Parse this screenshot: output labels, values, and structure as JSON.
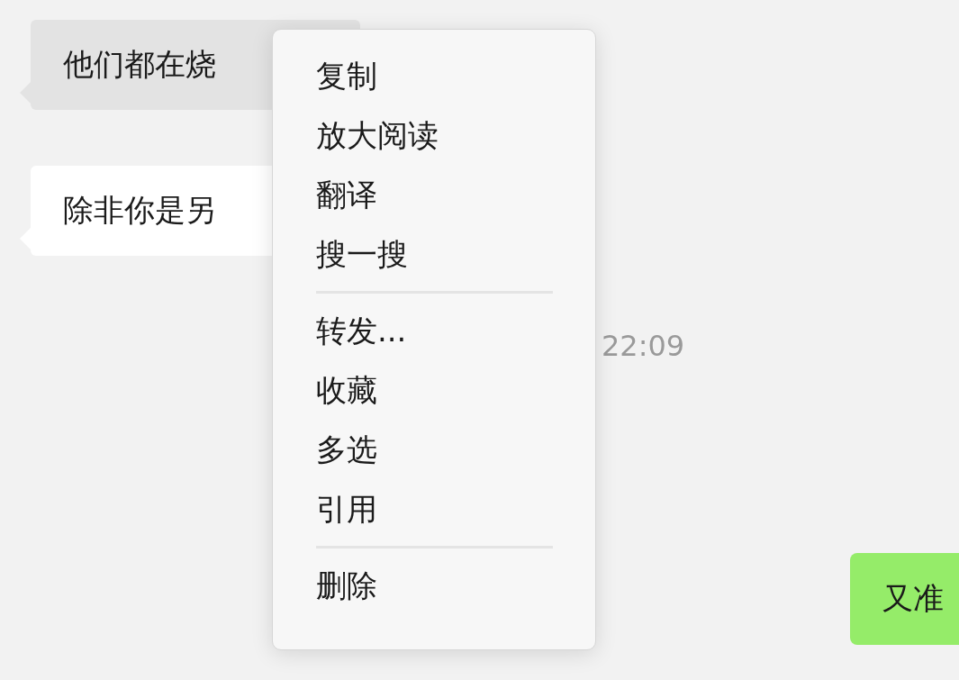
{
  "messages": [
    {
      "text": "他们都在烧",
      "selected": true
    },
    {
      "text": "除非你是另",
      "selected": false
    }
  ],
  "timestamp": "22:09",
  "outgoing": {
    "text": "又准"
  },
  "context_menu": {
    "groups": [
      [
        "复制",
        "放大阅读",
        "翻译",
        "搜一搜"
      ],
      [
        "转发...",
        "收藏",
        "多选",
        "引用"
      ],
      [
        "删除"
      ]
    ]
  }
}
